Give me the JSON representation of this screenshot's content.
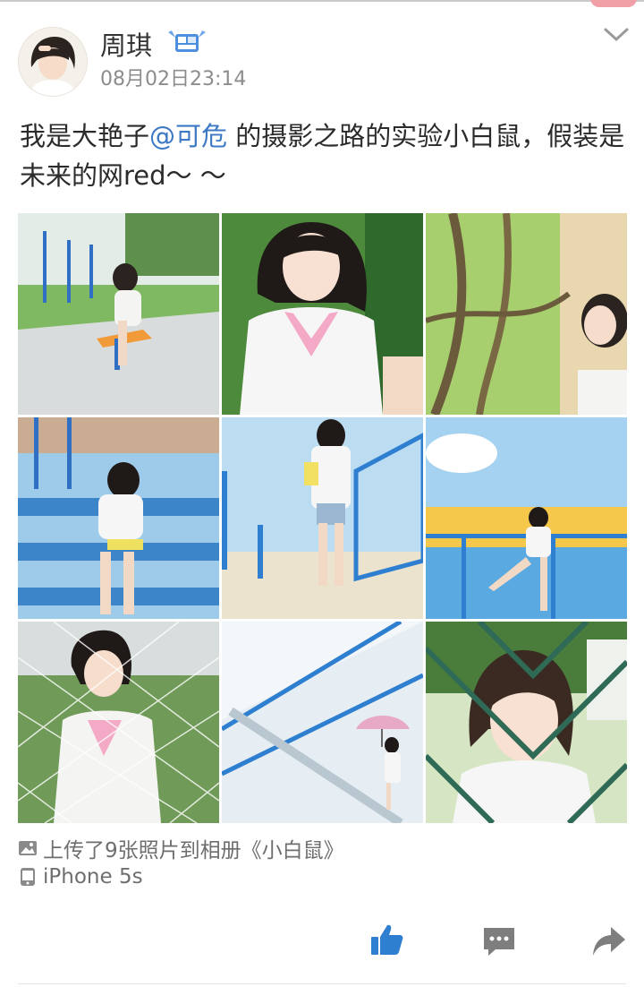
{
  "post": {
    "username": "周琪",
    "timestamp": "08月02日23:14",
    "text_before": "我是大艳子",
    "mention": "@可危",
    "text_after": " 的摄影之路的实验小白鼠，假装是未来的网red～ ～",
    "photos": [
      {
        "icon": "photo-playground"
      },
      {
        "icon": "photo-portrait-grass"
      },
      {
        "icon": "photo-tree-vines"
      },
      {
        "icon": "photo-bleachers-reading"
      },
      {
        "icon": "photo-stairs-standing"
      },
      {
        "icon": "photo-yellow-wall"
      },
      {
        "icon": "photo-goal-net"
      },
      {
        "icon": "photo-umbrella-stairs"
      },
      {
        "icon": "photo-fence-portrait"
      }
    ],
    "album_text": "上传了9张照片到相册《小白鼠》",
    "device_text": "iPhone 5s"
  },
  "colors": {
    "mention": "#3c78c3",
    "action_icon": "#2f7fd1",
    "secondary_text": "#8c8c8c"
  },
  "icons": {
    "more": "chevron-down-icon",
    "album": "image-icon",
    "device": "phone-icon",
    "like": "thumbs-up-icon",
    "comment": "comment-icon",
    "repost": "share-arrow-icon"
  }
}
